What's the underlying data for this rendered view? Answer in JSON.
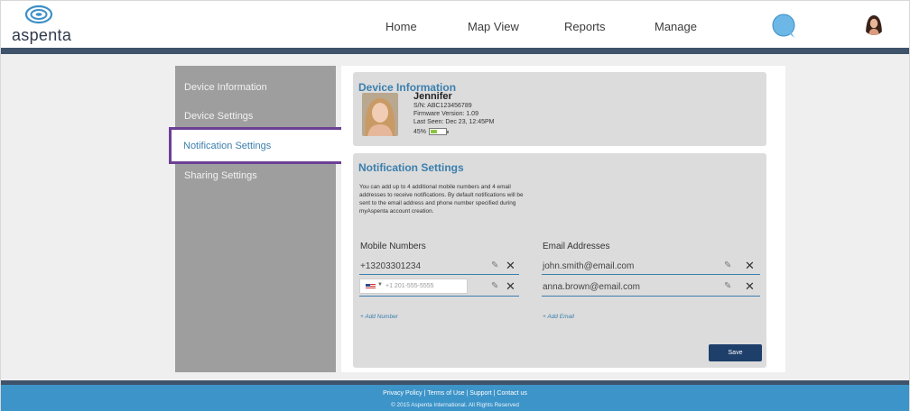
{
  "header": {
    "logo_text": "aspenta",
    "nav": {
      "home": "Home",
      "map_view": "Map View",
      "reports": "Reports",
      "manage": "Manage"
    }
  },
  "sidebar": {
    "items": [
      {
        "label": "Device Information"
      },
      {
        "label": "Device Settings"
      },
      {
        "label": "Notification Settings"
      },
      {
        "label": "Sharing Settings"
      }
    ],
    "active_index": 2
  },
  "device": {
    "title": "Device Information",
    "name": "Jennifer",
    "serial": "S/N: ABC123456789",
    "firmware": "Firmware Version: 1.09",
    "last_seen": "Last Seen: Dec 23, 12:45PM",
    "battery_label": "45%",
    "battery_level": 0.45
  },
  "notifications": {
    "title": "Notification Settings",
    "description_lines": [
      "You can add up to 4 additional mobile numbers and 4 email",
      "addresses to receive notifications. By default notifications will be",
      "sent to the email address and phone number specified during",
      "myAspenta account creation."
    ],
    "mobile_header": "Mobile Numbers",
    "email_header": "Email Addresses",
    "mobile_numbers": [
      "+13203301234"
    ],
    "phone_placeholder": "+1 201-555-5555",
    "emails": [
      "john.smith@email.com",
      "anna.brown@email.com"
    ],
    "add_number": "+ Add Number",
    "add_email": "+ Add Email",
    "save_label": "Save"
  },
  "footer": {
    "links": "Privacy Policy | Terms of Use | Support | Contact us",
    "copyright": "© 2015 Aspenta International. All Rights Reserved"
  },
  "colors": {
    "accent": "#3b7fae",
    "header_bar": "#3f536b",
    "footer": "#3d94c8",
    "active_outline": "#6b3f95",
    "save_button": "#1f3f6b"
  }
}
